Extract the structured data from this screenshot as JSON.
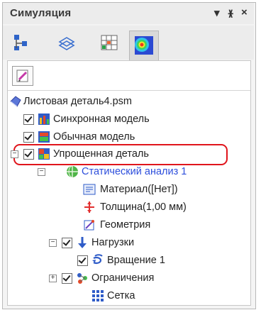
{
  "panel": {
    "title": "Симуляция",
    "controls": [
      "▾",
      "ᵠ",
      "×"
    ]
  },
  "tabs": [
    {
      "name": "structure-tab"
    },
    {
      "name": "layers-tab"
    },
    {
      "name": "mesh-tab"
    },
    {
      "name": "results-tab",
      "active": true
    }
  ],
  "tree": {
    "root": "Листовая деталь4.psm",
    "items": {
      "sync_model": "Синхронная модель",
      "ordinary_model": "Обычная модель",
      "simplified_part": "Упрощенная деталь",
      "static_analysis": "Статический анализ 1",
      "material": "Материал([Нет])",
      "thickness": "Толщина(1,00 мм)",
      "geometry": "Геометрия",
      "loads": "Нагрузки",
      "rotation": "Вращение 1",
      "constraints": "Ограничения",
      "mesh": "Сетка"
    }
  },
  "colors": {
    "highlight": "#e0151c",
    "analysis_text": "#2e4fdc"
  }
}
